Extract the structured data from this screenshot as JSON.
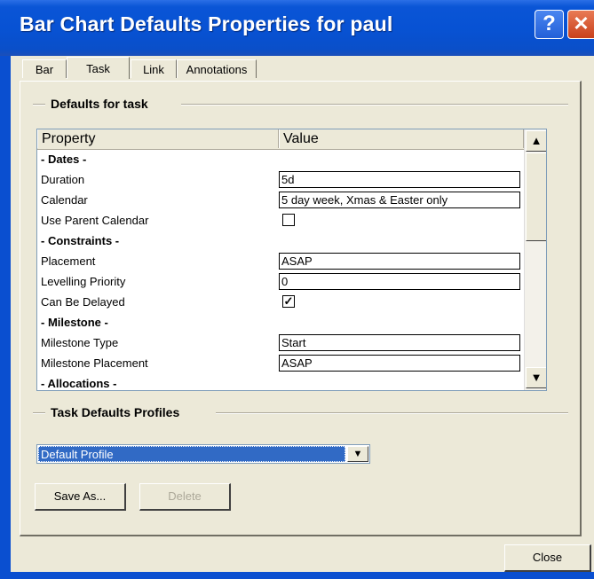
{
  "window": {
    "title": "Bar Chart Defaults Properties for paul",
    "help_label": "?",
    "close_label": "✕"
  },
  "tabs": [
    {
      "label": "Bar",
      "active": false
    },
    {
      "label": "Task",
      "active": true
    },
    {
      "label": "Link",
      "active": false
    },
    {
      "label": "Annotations",
      "active": false
    }
  ],
  "defaults_group": {
    "title": "Defaults for task",
    "columns": {
      "property": "Property",
      "value": "Value"
    },
    "rows": [
      {
        "type": "section",
        "label": "- Dates -"
      },
      {
        "type": "text",
        "label": "Duration",
        "value": "5d"
      },
      {
        "type": "text",
        "label": "Calendar",
        "value": "5 day week, Xmas & Easter only"
      },
      {
        "type": "check",
        "label": "Use Parent Calendar",
        "checked": false
      },
      {
        "type": "section",
        "label": "- Constraints -"
      },
      {
        "type": "text",
        "label": "Placement",
        "value": "ASAP"
      },
      {
        "type": "text",
        "label": "Levelling Priority",
        "value": "0"
      },
      {
        "type": "check",
        "label": "Can Be Delayed",
        "checked": true
      },
      {
        "type": "section",
        "label": "- Milestone -"
      },
      {
        "type": "text",
        "label": "Milestone Type",
        "value": "Start"
      },
      {
        "type": "text",
        "label": "Milestone Placement",
        "value": "ASAP"
      },
      {
        "type": "section",
        "label": "- Allocations -"
      }
    ]
  },
  "profiles_group": {
    "title": "Task Defaults Profiles",
    "selected_profile": "Default Profile",
    "save_as_label": "Save As...",
    "delete_label": "Delete"
  },
  "footer": {
    "close_label": "Close"
  },
  "icons": {
    "scroll_up": "▲",
    "scroll_down": "▼",
    "dropdown": "▼",
    "check_mark": "✓"
  },
  "colors": {
    "titlebar": "#0a55d6",
    "dialog_bg": "#ece9d8",
    "selection": "#316ac5",
    "close_button": "#c8401c"
  }
}
